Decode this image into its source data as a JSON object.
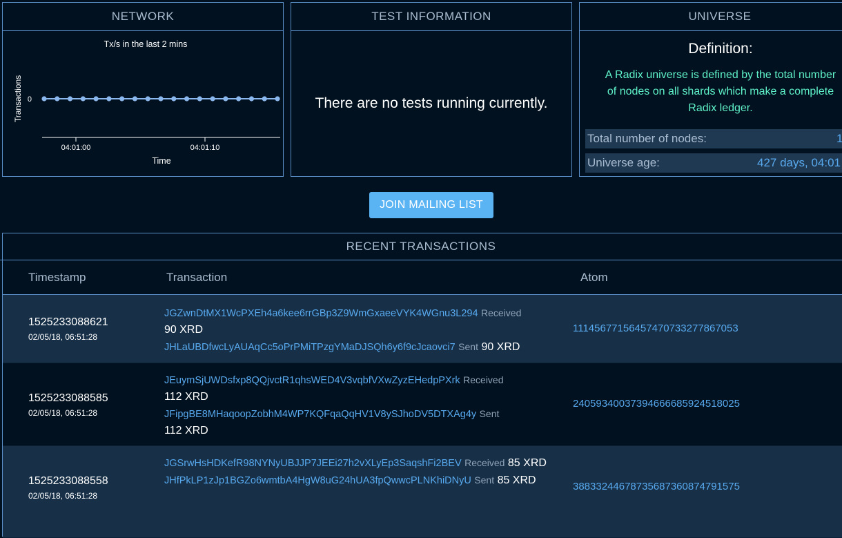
{
  "network": {
    "title": "NETWORK",
    "chart_data": {
      "type": "line",
      "title": "Tx/s in the last 2 mins",
      "xlabel": "Time",
      "ylabel": "Transactions",
      "y_ticks": [
        "0"
      ],
      "x_ticks": [
        "04:01:00",
        "04:01:10"
      ],
      "series": [
        {
          "values": [
            0,
            0,
            0,
            0,
            0,
            0,
            0,
            0,
            0,
            0,
            0,
            0,
            0,
            0,
            0,
            0,
            0,
            0,
            0
          ]
        }
      ],
      "ylim": [
        0,
        0
      ],
      "color": "#8ab8ee"
    }
  },
  "test_info": {
    "title": "TEST INFORMATION",
    "message": "There are no tests running currently."
  },
  "universe": {
    "title": "UNIVERSE",
    "definition_title": "Definition:",
    "definition_lines": [
      "A Radix universe is defined by the total number",
      "of nodes on all shards which make a complete",
      "Radix ledger."
    ],
    "nodes_label": "Total number of nodes:",
    "nodes_value": "1",
    "age_label": "Universe age:",
    "age_value": "427 days, 04:01"
  },
  "mailing_button": "JOIN MAILING LIST",
  "recent": {
    "title": "RECENT TRANSACTIONS",
    "headers": {
      "timestamp": "Timestamp",
      "transaction": "Transaction",
      "atom": "Atom"
    },
    "rows": [
      {
        "ts": "1525233088621",
        "date": "02/05/18, 06:51:28",
        "received_addr": "JGZwnDtMX1WcPXEh4a6kee6rrGBp3Z9WmGxaeeVYK4WGnu3L294",
        "received_label": "Received",
        "received_amount": "90 XRD",
        "sent_addr": "JHLaUBDfwcLyAUAqCc5oPrPMiTPzgYMaDJSQh6y6f9cJcaovci7",
        "sent_label": "Sent",
        "sent_amount": "90 XRD",
        "atom": "1114567715645747073327786705 3"
      },
      {
        "ts": "1525233088585",
        "date": "02/05/18, 06:51:28",
        "received_addr": "JEuymSjUWDsfxp8QQjvctR1qhsWED4V3vqbfVXwZyzEHedpPXrk",
        "received_label": "Received",
        "received_amount": "112 XRD",
        "sent_addr": "JFipgBE8MHaqoopZobhM4WP7KQFqaQqHV1V8ySJhoDV5DTXAg4y",
        "sent_label": "Sent",
        "sent_amount": "112 XRD",
        "atom": "24059340037394666685924518025"
      },
      {
        "ts": "1525233088558",
        "date": "02/05/18, 06:51:28",
        "received_addr": "JGSrwHsHDKefR98NYNyUBJJP7JEEi27h2vXLyEp3SaqshFi2BEV",
        "received_label": "Received",
        "received_amount": "85 XRD",
        "sent_addr": "JHfPkLP1zJp1BGZo6wmtbA4HgW8uG24hUA3fpQwwcPLNKhiDNyU",
        "sent_label": "Sent",
        "sent_amount": "85 XRD",
        "atom": "38833244678735687360874791575"
      }
    ]
  }
}
